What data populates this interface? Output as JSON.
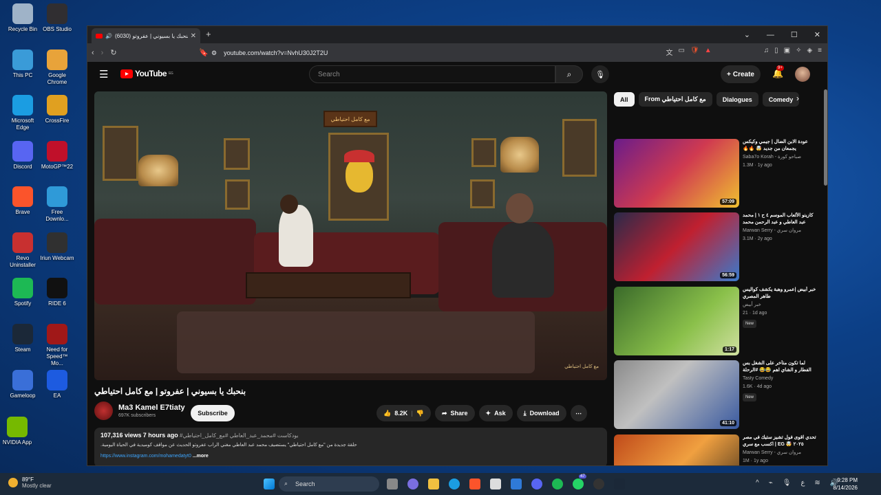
{
  "desktop": {
    "icons": [
      {
        "label": "Recycle Bin",
        "icon": "recycle-bin-icon",
        "color": "#9fb3c8"
      },
      {
        "label": "OBS Studio",
        "icon": "obs-icon",
        "color": "#302e31"
      },
      {
        "label": "This PC",
        "icon": "computer-icon",
        "color": "#3a9bd8"
      },
      {
        "label": "Google Chrome",
        "icon": "chrome-icon",
        "color": "#e8a33a"
      },
      {
        "label": "Microsoft Edge",
        "icon": "edge-icon",
        "color": "#1b9de2"
      },
      {
        "label": "CrossFire",
        "icon": "crossfire-icon",
        "color": "#e0a020"
      },
      {
        "label": "Discord",
        "icon": "discord-icon",
        "color": "#5865f2"
      },
      {
        "label": "MotoGP™22",
        "icon": "motogp-icon",
        "color": "#c0102a"
      },
      {
        "label": "Brave",
        "icon": "brave-icon",
        "color": "#fb542b"
      },
      {
        "label": "Free Downlo...",
        "icon": "download-icon",
        "color": "#2f9ad8"
      },
      {
        "label": "Revo Uninstaller",
        "icon": "revo-icon",
        "color": "#c83030"
      },
      {
        "label": "Iriun Webcam",
        "icon": "webcam-icon",
        "color": "#303030"
      },
      {
        "label": "Spotify",
        "icon": "spotify-icon",
        "color": "#1db954"
      },
      {
        "label": "RIDE 6",
        "icon": "ride-icon",
        "color": "#111111"
      },
      {
        "label": "Steam",
        "icon": "steam-icon",
        "color": "#1b2838"
      },
      {
        "label": "Need for Speed™ Mo...",
        "icon": "nfs-icon",
        "color": "#a01818"
      },
      {
        "label": "Gameloop",
        "icon": "gameloop-icon",
        "color": "#3a6fd8"
      },
      {
        "label": "EA",
        "icon": "ea-icon",
        "color": "#1d5be0"
      },
      {
        "label": "NVIDIA App",
        "icon": "nvidia-icon",
        "color": "#76b900"
      }
    ]
  },
  "browser": {
    "tab_title": "(6030) بنحبك يا بسيوني | عفروتو...",
    "url": "youtube.com/watch?v=NvhU30J2T2U"
  },
  "youtube": {
    "logo_text": "YouTube",
    "logo_region": "EG",
    "search_placeholder": "Search",
    "create_label": "Create",
    "notif_count": "9+",
    "video": {
      "title": "بنحبك يا بسيوني | عفروتو | مع كامل احتياطي",
      "sign_text": "مع كامل احتياطي",
      "channel": "Ma3 Kamel E7tiaty",
      "subscribers": "697K subscribers",
      "subscribe_label": "Subscribe",
      "likes": "8.2K",
      "share_label": "Share",
      "ask_label": "Ask",
      "download_label": "Download",
      "views": "107,316 views",
      "age": "7 hours ago",
      "hashtags": "#بودكاست #محمد_عبد_العاطي #مع_كامل_احتياطي",
      "description": "حلقة جديدة من \"مع كامل احتياطي\" يستضيف محمد عبد العاطي مغني الراب عفروتو الحديث عن مواقف كوميدية في الحياة اليومية.",
      "link_text": "https://www.instagram.com/mohamedatyt0",
      "more_label": "...more"
    },
    "chips": [
      "All",
      "From مع كامل احتياطي",
      "Dialogues",
      "Comedy"
    ],
    "recommendations": [
      {
        "title": "عودة الابن الضال | جيمي وكيكس يجمعان من جديد 🤯 🔥🔥",
        "channel": "Saba7o Korah - صباحو كورة",
        "stats": "1.3M · 1y ago",
        "duration": "57:09",
        "new": ""
      },
      {
        "title": "كازينو الألعاب الموسم ٤ ح ١ | محمد عبد العاطي و عبد الرحمن محمد",
        "channel": "Marwan Serry - مروان سري",
        "stats": "3.1M · 2y ago",
        "duration": "56:59",
        "new": ""
      },
      {
        "title": "خبر أبيض |عمرو وهبة يكشف كواليس طاهر المصري",
        "channel": "خبر أبيض",
        "stats": "21 · 1d ago",
        "duration": "1:17",
        "new": "New"
      },
      {
        "title": "لما تكون متأخر على الشغل بس الفطار و الشاي اهم 😂😂 #الرحلة",
        "channel": "Tasty Comedy",
        "stats": "1.6K · 4d ago",
        "duration": "41:10",
        "new": "New"
      },
      {
        "title": "تحدي اقوى فول تشيز ستيك في مصر ٢٠٢٥ 🤯 EG | اكسب مع سري",
        "channel": "Marwan Serry - مروان سري",
        "stats": "1M · 1y ago",
        "duration": "",
        "new": ""
      }
    ]
  },
  "taskbar": {
    "temperature": "89°F",
    "weather": "Mostly clear",
    "search_label": "Search",
    "time": "9:28 PM",
    "date": "8/14/2026",
    "whatsapp_badge": "47"
  }
}
